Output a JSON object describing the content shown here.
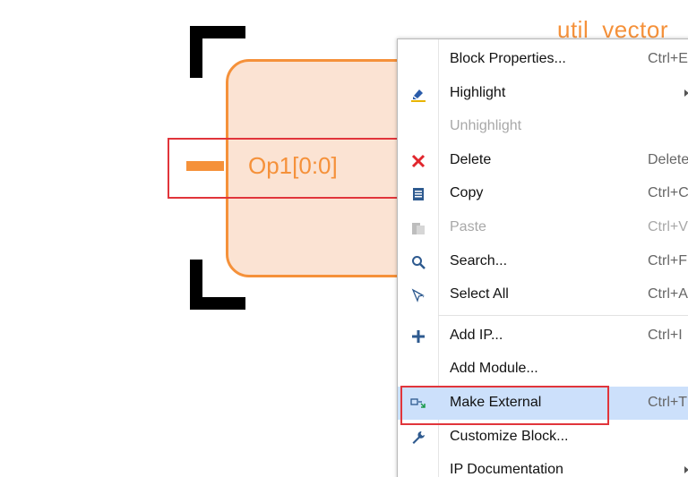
{
  "block": {
    "title": "util_vector",
    "port_label": "Op1[0:0]"
  },
  "colors": {
    "block_fill": "#fbe3d3",
    "block_stroke": "#f5913a",
    "annotation_red": "#e1353b",
    "menu_selected": "#cce0fb"
  },
  "menu": {
    "items": [
      {
        "label": "Block Properties...",
        "shortcut": "Ctrl+E",
        "icon": "none",
        "enabled": true
      },
      {
        "label": "Highlight",
        "shortcut": "",
        "icon": "highlight-pen-icon",
        "enabled": true,
        "submenu": true
      },
      {
        "label": "Unhighlight",
        "shortcut": "",
        "icon": "none",
        "enabled": false
      },
      {
        "label": "Delete",
        "shortcut": "Delete",
        "icon": "delete-x-icon",
        "enabled": true
      },
      {
        "label": "Copy",
        "shortcut": "Ctrl+C",
        "icon": "copy-icon",
        "enabled": true
      },
      {
        "label": "Paste",
        "shortcut": "Ctrl+V",
        "icon": "paste-icon",
        "enabled": false
      },
      {
        "label": "Search...",
        "shortcut": "Ctrl+F",
        "icon": "search-icon",
        "enabled": true
      },
      {
        "label": "Select All",
        "shortcut": "Ctrl+A",
        "icon": "select-all-icon",
        "enabled": true
      },
      {
        "label": "Add IP...",
        "shortcut": "Ctrl+I",
        "icon": "plus-icon",
        "enabled": true
      },
      {
        "label": "Add Module...",
        "shortcut": "",
        "icon": "none",
        "enabled": true
      },
      {
        "label": "Make External",
        "shortcut": "Ctrl+T",
        "icon": "make-external-icon",
        "enabled": true,
        "selected": true
      },
      {
        "label": "Customize Block...",
        "shortcut": "",
        "icon": "wrench-icon",
        "enabled": true
      },
      {
        "label": "IP Documentation",
        "shortcut": "",
        "icon": "none",
        "enabled": true,
        "submenu": true
      }
    ]
  }
}
